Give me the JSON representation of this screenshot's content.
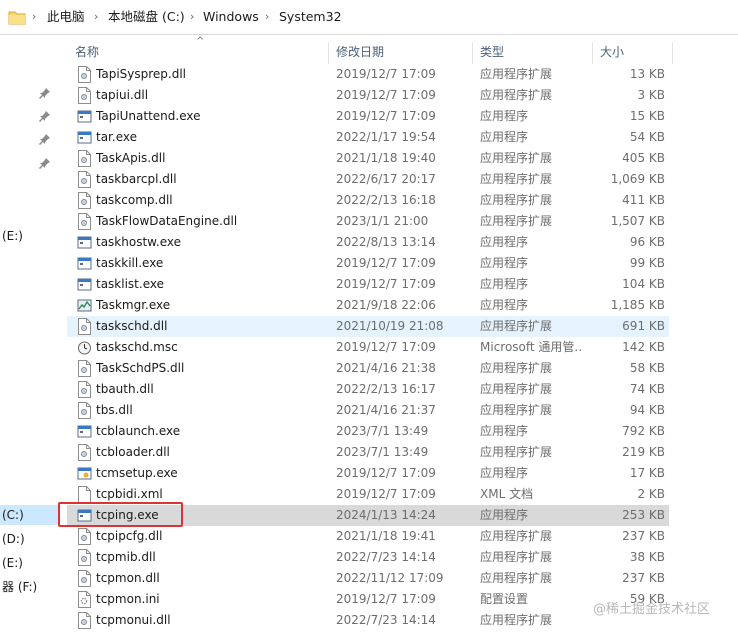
{
  "breadcrumb": [
    "此电脑",
    "本地磁盘 (C:)",
    "Windows",
    "System32"
  ],
  "nav": {
    "drives": [
      {
        "label": "(E:)",
        "selected": false
      },
      {
        "label": "(C:)",
        "selected": true
      },
      {
        "label": "(D:)",
        "selected": false
      },
      {
        "label": "(E:)",
        "selected": false
      },
      {
        "label": "器 (F:)",
        "selected": false
      }
    ]
  },
  "columns": {
    "name": "名称",
    "date": "修改日期",
    "type": "类型",
    "size": "大小"
  },
  "files": [
    {
      "name": "TapiSysprep.dll",
      "date": "2019/12/7 17:09",
      "type": "应用程序扩展",
      "size": "13 KB",
      "icon": "dll-icon",
      "state": ""
    },
    {
      "name": "tapiui.dll",
      "date": "2019/12/7 17:09",
      "type": "应用程序扩展",
      "size": "3 KB",
      "icon": "dll-icon",
      "state": ""
    },
    {
      "name": "TapiUnattend.exe",
      "date": "2019/12/7 17:09",
      "type": "应用程序",
      "size": "15 KB",
      "icon": "exe-icon",
      "state": ""
    },
    {
      "name": "tar.exe",
      "date": "2022/1/17 19:54",
      "type": "应用程序",
      "size": "54 KB",
      "icon": "exe-icon",
      "state": ""
    },
    {
      "name": "TaskApis.dll",
      "date": "2021/1/18 19:40",
      "type": "应用程序扩展",
      "size": "405 KB",
      "icon": "dll-icon",
      "state": ""
    },
    {
      "name": "taskbarcpl.dll",
      "date": "2022/6/17 20:17",
      "type": "应用程序扩展",
      "size": "1,069 KB",
      "icon": "dll-icon",
      "state": ""
    },
    {
      "name": "taskcomp.dll",
      "date": "2022/2/13 16:18",
      "type": "应用程序扩展",
      "size": "411 KB",
      "icon": "dll-icon",
      "state": ""
    },
    {
      "name": "TaskFlowDataEngine.dll",
      "date": "2023/1/1 21:00",
      "type": "应用程序扩展",
      "size": "1,507 KB",
      "icon": "dll-icon",
      "state": ""
    },
    {
      "name": "taskhostw.exe",
      "date": "2022/8/13 13:14",
      "type": "应用程序",
      "size": "96 KB",
      "icon": "exe-icon",
      "state": ""
    },
    {
      "name": "taskkill.exe",
      "date": "2019/12/7 17:09",
      "type": "应用程序",
      "size": "99 KB",
      "icon": "exe-icon",
      "state": ""
    },
    {
      "name": "tasklist.exe",
      "date": "2019/12/7 17:09",
      "type": "应用程序",
      "size": "104 KB",
      "icon": "exe-icon",
      "state": ""
    },
    {
      "name": "Taskmgr.exe",
      "date": "2021/9/18 22:06",
      "type": "应用程序",
      "size": "1,185 KB",
      "icon": "taskmgr-icon",
      "state": ""
    },
    {
      "name": "taskschd.dll",
      "date": "2021/10/19 21:08",
      "type": "应用程序扩展",
      "size": "691 KB",
      "icon": "dll-icon",
      "state": "hover"
    },
    {
      "name": "taskschd.msc",
      "date": "2019/12/7 17:09",
      "type": "Microsoft 通用管...",
      "size": "142 KB",
      "icon": "clock-icon",
      "state": ""
    },
    {
      "name": "TaskSchdPS.dll",
      "date": "2021/4/16 21:38",
      "type": "应用程序扩展",
      "size": "58 KB",
      "icon": "dll-icon",
      "state": ""
    },
    {
      "name": "tbauth.dll",
      "date": "2022/2/13 16:17",
      "type": "应用程序扩展",
      "size": "74 KB",
      "icon": "dll-icon",
      "state": ""
    },
    {
      "name": "tbs.dll",
      "date": "2021/4/16 21:37",
      "type": "应用程序扩展",
      "size": "94 KB",
      "icon": "dll-icon",
      "state": ""
    },
    {
      "name": "tcblaunch.exe",
      "date": "2023/7/1 13:49",
      "type": "应用程序",
      "size": "792 KB",
      "icon": "exe-icon",
      "state": ""
    },
    {
      "name": "tcbloader.dll",
      "date": "2023/7/1 13:49",
      "type": "应用程序扩展",
      "size": "219 KB",
      "icon": "dll-icon",
      "state": ""
    },
    {
      "name": "tcmsetup.exe",
      "date": "2019/12/7 17:09",
      "type": "应用程序",
      "size": "17 KB",
      "icon": "setup-icon",
      "state": ""
    },
    {
      "name": "tcpbidi.xml",
      "date": "2019/12/7 17:09",
      "type": "XML 文档",
      "size": "2 KB",
      "icon": "file-icon",
      "state": ""
    },
    {
      "name": "tcping.exe",
      "date": "2024/1/13 14:24",
      "type": "应用程序",
      "size": "253 KB",
      "icon": "exe-icon",
      "state": "selected"
    },
    {
      "name": "tcpipcfg.dll",
      "date": "2021/1/18 19:41",
      "type": "应用程序扩展",
      "size": "237 KB",
      "icon": "dll-icon",
      "state": ""
    },
    {
      "name": "tcpmib.dll",
      "date": "2022/7/23 14:14",
      "type": "应用程序扩展",
      "size": "38 KB",
      "icon": "dll-icon",
      "state": ""
    },
    {
      "name": "tcpmon.dll",
      "date": "2022/11/12 17:09",
      "type": "应用程序扩展",
      "size": "237 KB",
      "icon": "dll-icon",
      "state": ""
    },
    {
      "name": "tcpmon.ini",
      "date": "2019/12/7 17:09",
      "type": "配置设置",
      "size": "59 KB",
      "icon": "ini-icon",
      "state": ""
    },
    {
      "name": "tcpmonui.dll",
      "date": "2022/7/23 14:14",
      "type": "应用程序扩展",
      "size": "",
      "icon": "dll-icon",
      "state": ""
    }
  ],
  "watermark": "@稀土掘金技术社区"
}
